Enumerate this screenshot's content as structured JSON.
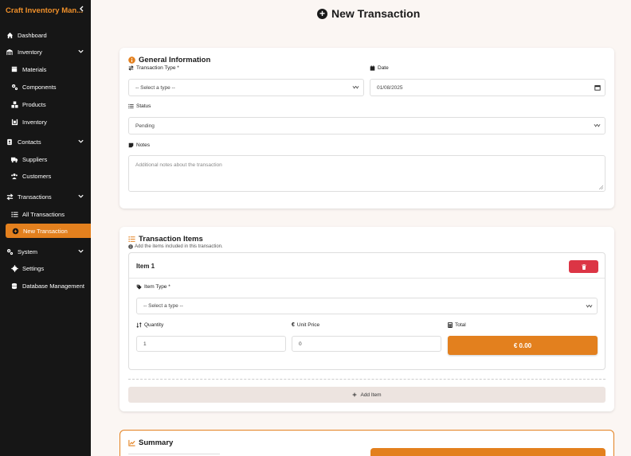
{
  "sidebar": {
    "brand": "Craft Inventory Man...",
    "items": [
      {
        "label": "Dashboard",
        "icon": "house-icon"
      },
      {
        "label": "Inventory",
        "icon": "warehouse-icon"
      },
      {
        "label": "Materials",
        "icon": "box-icon"
      },
      {
        "label": "Components",
        "icon": "cogs-icon"
      },
      {
        "label": "Products",
        "icon": "cubes-icon"
      },
      {
        "label": "Inventory",
        "icon": "pallet-icon"
      },
      {
        "label": "Contacts",
        "icon": "address-book-icon"
      },
      {
        "label": "Suppliers",
        "icon": "truck-icon"
      },
      {
        "label": "Customers",
        "icon": "users-icon"
      },
      {
        "label": "Transactions",
        "icon": "exchange-icon"
      },
      {
        "label": "All Transactions",
        "icon": "list-icon"
      },
      {
        "label": "New Transaction",
        "icon": "plus-circle-icon"
      },
      {
        "label": "System",
        "icon": "cogs-icon"
      },
      {
        "label": "Settings",
        "icon": "gear-icon"
      },
      {
        "label": "Database Management",
        "icon": "database-icon"
      }
    ]
  },
  "page": {
    "title": "New Transaction"
  },
  "general": {
    "title": "General Information",
    "transaction_type_label": "Transaction Type *",
    "transaction_type_value": "-- Select a type --",
    "date_label": "Date",
    "date_value": "01/08/2025",
    "status_label": "Status",
    "status_value": "Pending",
    "notes_label": "Notes",
    "notes_placeholder": "Additional notes about the transaction"
  },
  "items": {
    "title": "Transaction Items",
    "subtitle": "Add the items included in this transaction.",
    "item_title": "Item 1",
    "item_type_label": "Item Type *",
    "item_type_value": "-- Select a type --",
    "quantity_label": "Quantity",
    "quantity_value": "1",
    "unit_price_label": "Unit Price",
    "unit_price_value": "0",
    "total_label": "Total",
    "total_value": "€ 0.00",
    "add_item_label": "Add Item"
  },
  "summary": {
    "title": "Summary"
  },
  "colors": {
    "accent": "#e3801e",
    "danger": "#dc3545",
    "sidebar": "#161616",
    "background": "#fbf6f3"
  }
}
